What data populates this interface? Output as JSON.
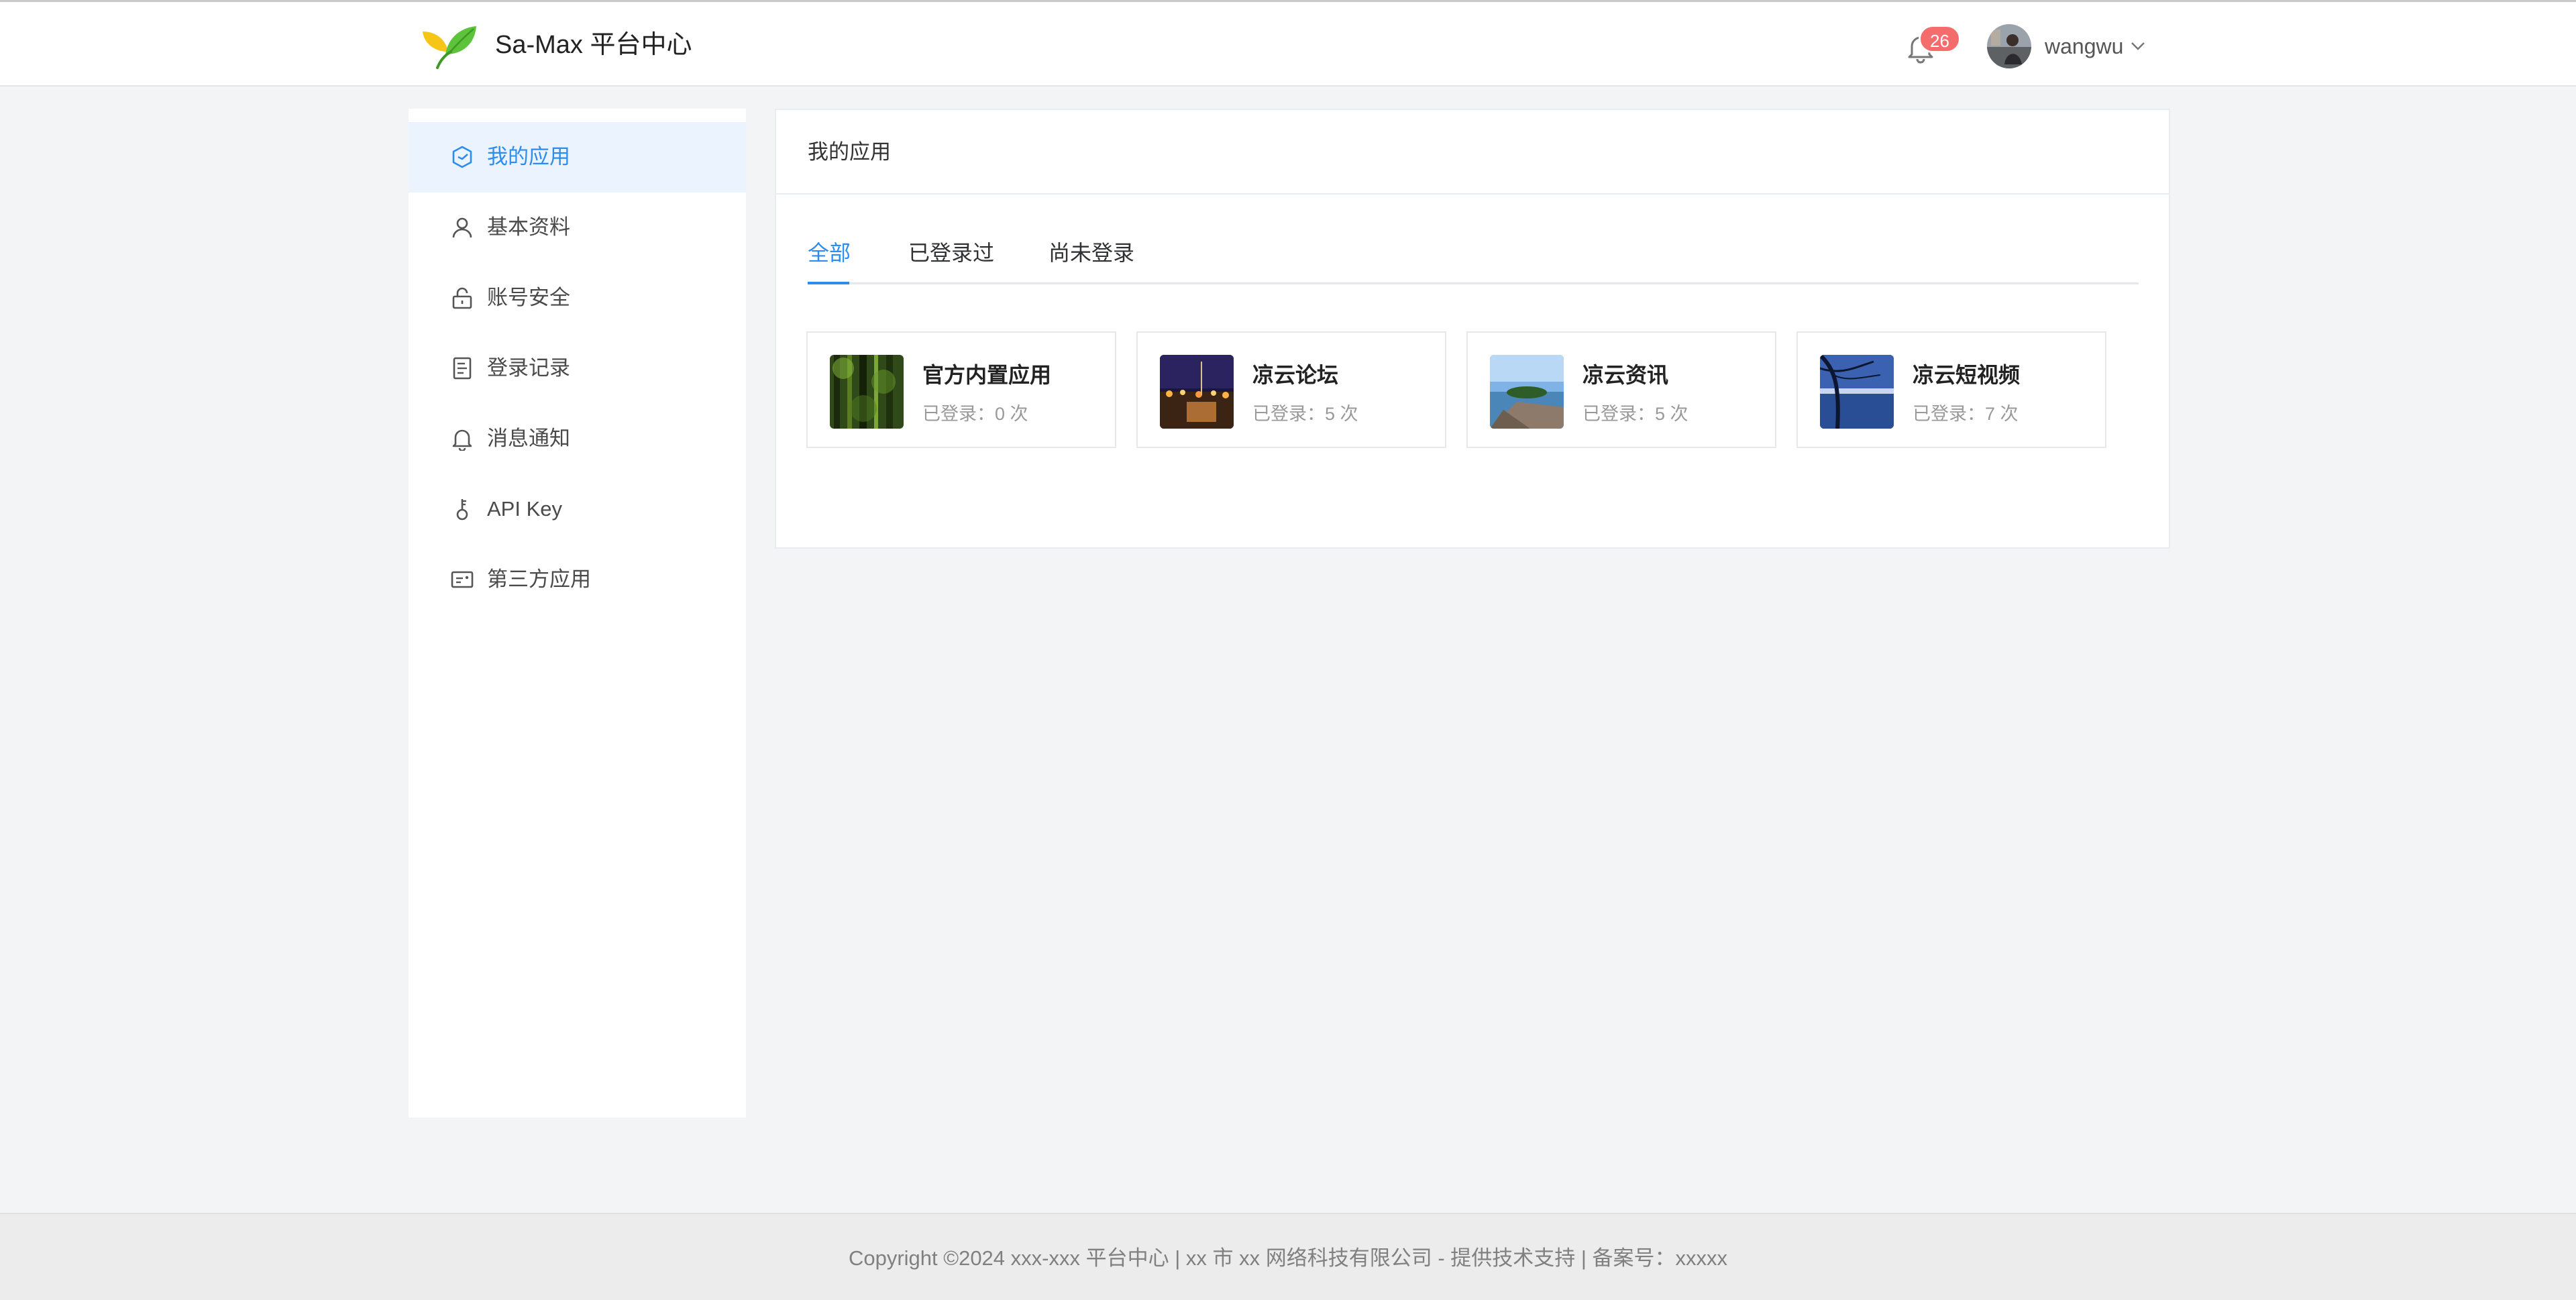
{
  "header": {
    "brand": "Sa-Max 平台中心",
    "notification_count": "26",
    "username": "wangwu",
    "icons": {
      "logo": "leaf-logo",
      "bell": "bell-icon",
      "caret": "chevron-down-icon"
    }
  },
  "sidebar": {
    "items": [
      {
        "label": "我的应用",
        "icon": "cube-icon",
        "active": true
      },
      {
        "label": "基本资料",
        "icon": "user-icon",
        "active": false
      },
      {
        "label": "账号安全",
        "icon": "lock-icon",
        "active": false
      },
      {
        "label": "登录记录",
        "icon": "document-icon",
        "active": false
      },
      {
        "label": "消息通知",
        "icon": "bell-icon",
        "active": false
      },
      {
        "label": "API Key",
        "icon": "key-icon",
        "active": false
      },
      {
        "label": "第三方应用",
        "icon": "id-card-icon",
        "active": false
      }
    ]
  },
  "main": {
    "title": "我的应用",
    "tabs": [
      {
        "label": "全部",
        "active": true
      },
      {
        "label": "已登录过",
        "active": false
      },
      {
        "label": "尚未登录",
        "active": false
      }
    ],
    "apps": [
      {
        "name": "官方内置应用",
        "logins": "已登录：0 次",
        "thumb": "forest"
      },
      {
        "name": "凉云论坛",
        "logins": "已登录：5 次",
        "thumb": "night-city"
      },
      {
        "name": "凉云资讯",
        "logins": "已登录：5 次",
        "thumb": "island"
      },
      {
        "name": "凉云短视频",
        "logins": "已登录：7 次",
        "thumb": "lake"
      }
    ]
  },
  "footer": {
    "copyright": "Copyright ©2024 xxx-xxx 平台中心 | xx 市 xx 网络科技有限公司 - 提供技术支持 | 备案号：xxxxx"
  },
  "colors": {
    "accent": "#2d8cf0",
    "badge": "#f56c6c",
    "active_bg": "#ebf3fe"
  }
}
